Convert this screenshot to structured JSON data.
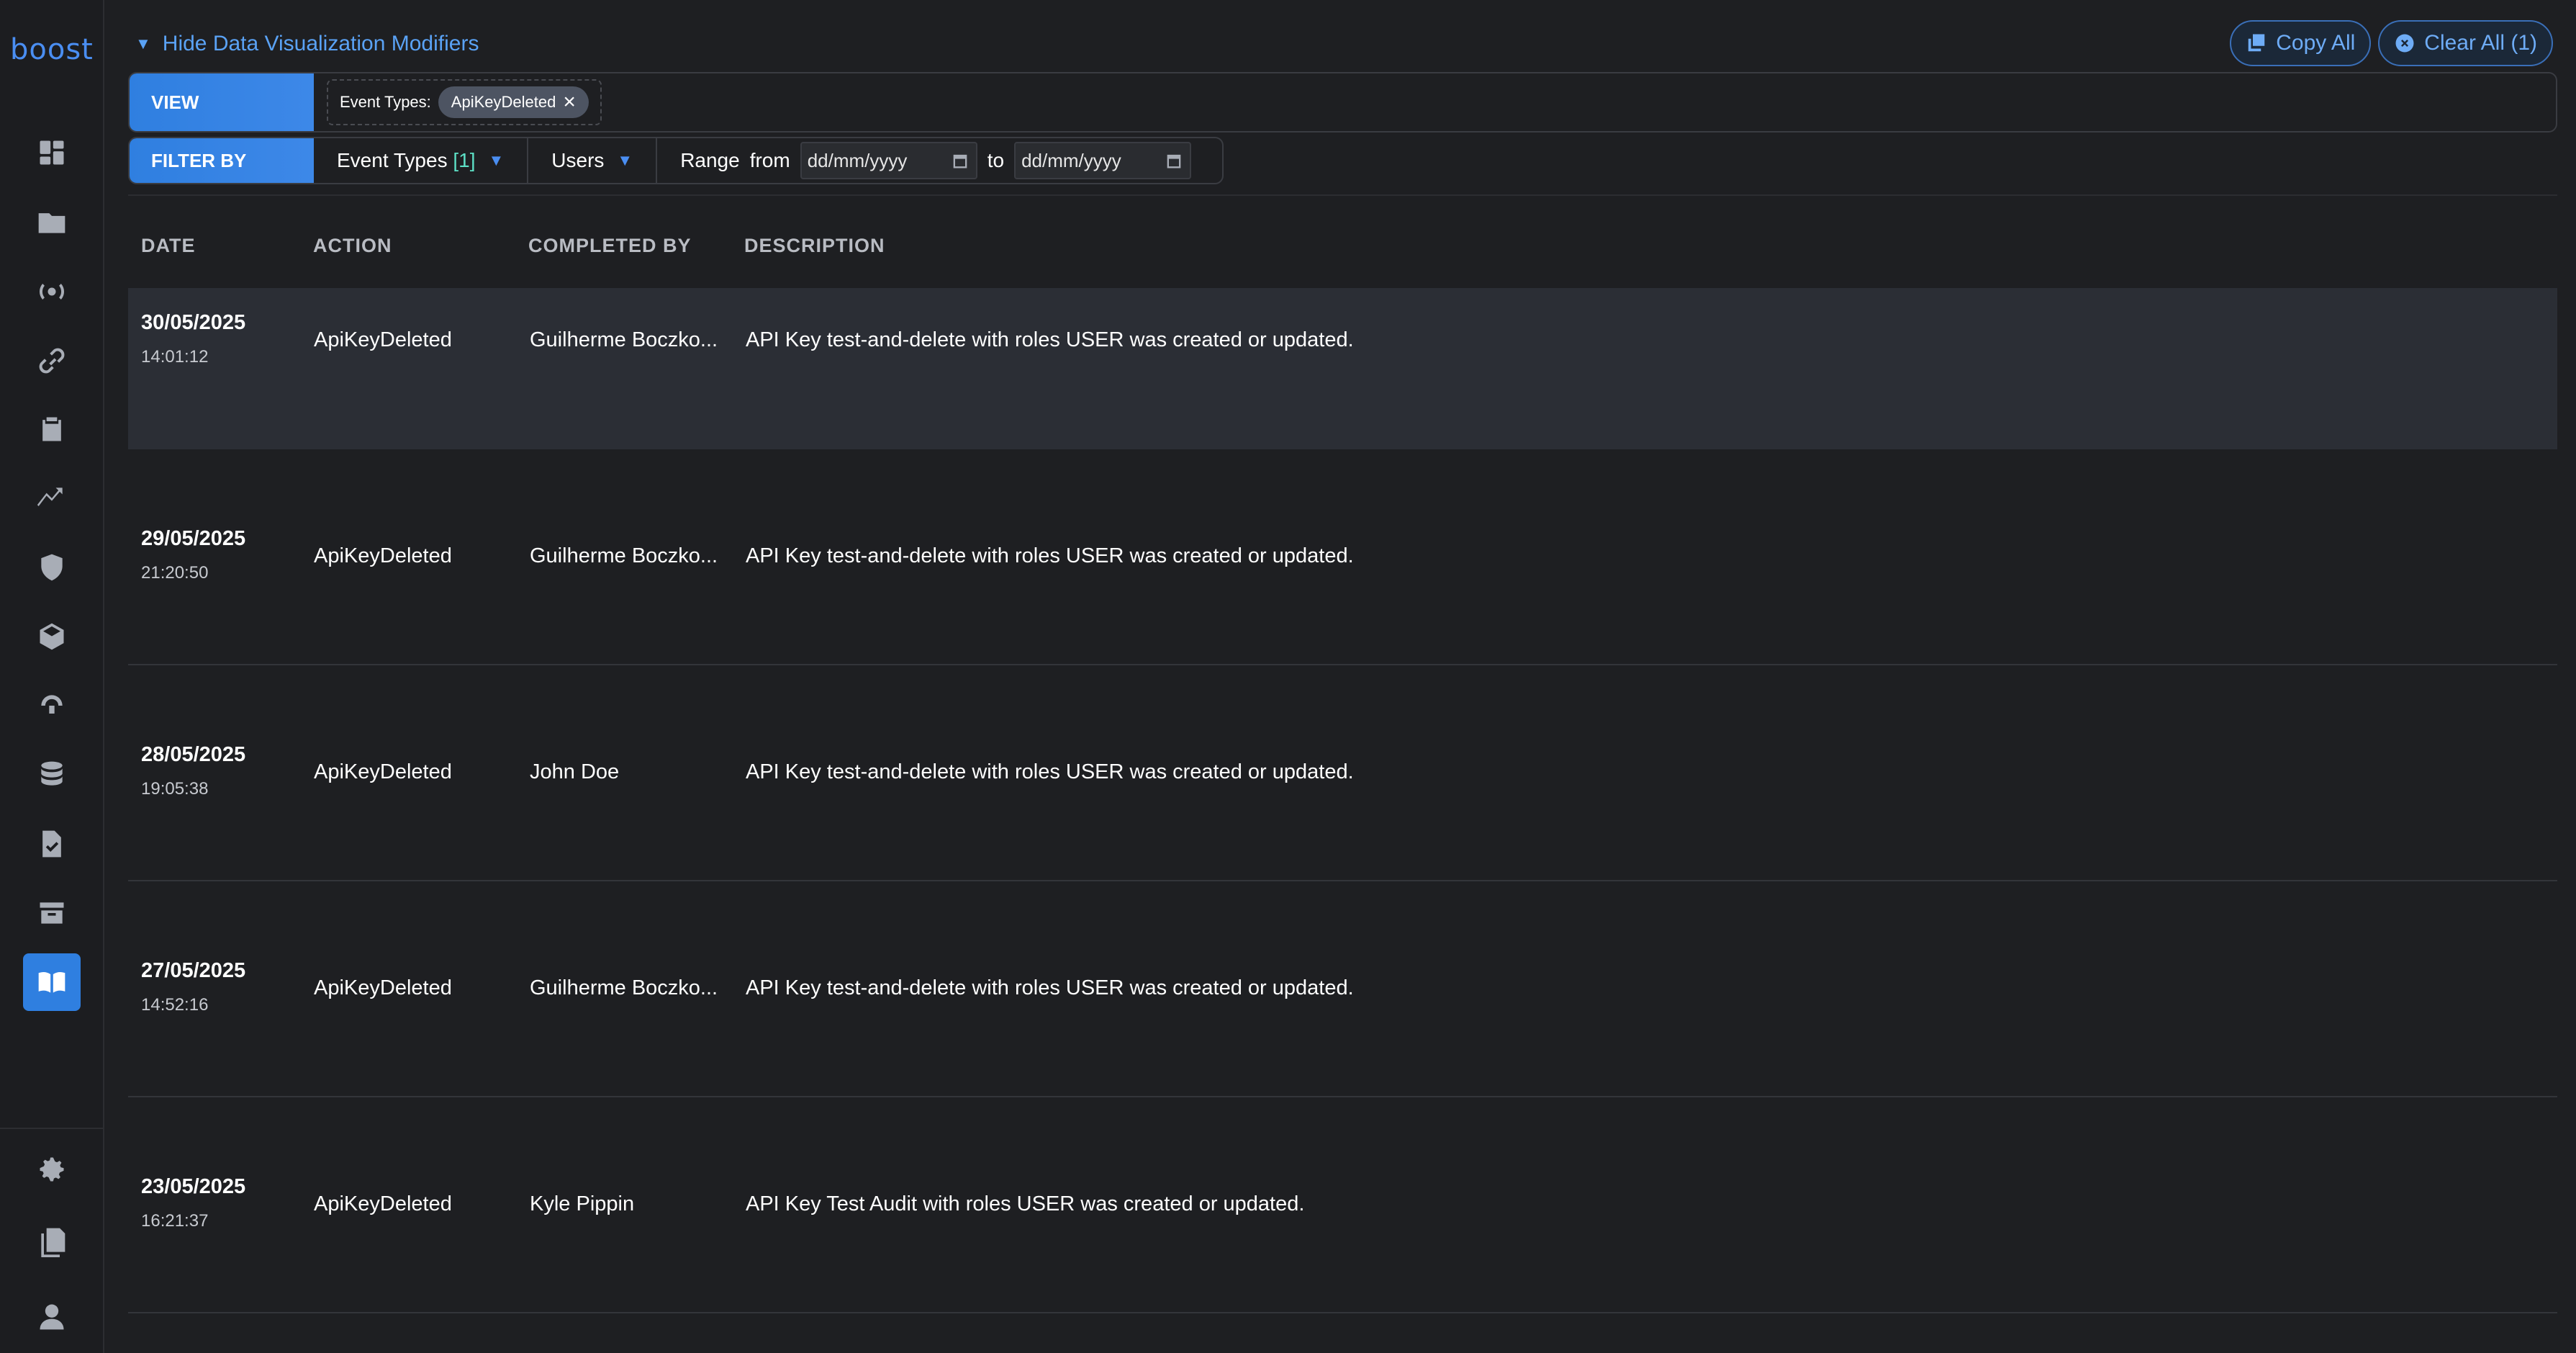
{
  "app": {
    "logo": "boost"
  },
  "sidebar": {
    "items": [
      {
        "icon": "dashboard-icon"
      },
      {
        "icon": "folder-icon"
      },
      {
        "icon": "broadcast-icon"
      },
      {
        "icon": "link-icon"
      },
      {
        "icon": "clipboard-icon"
      },
      {
        "icon": "trend-icon"
      },
      {
        "icon": "shield-icon"
      },
      {
        "icon": "cube-icon"
      },
      {
        "icon": "brain-icon"
      },
      {
        "icon": "database-icon"
      },
      {
        "icon": "file-check-icon"
      },
      {
        "icon": "archive-icon"
      },
      {
        "icon": "book-icon",
        "active": true
      }
    ],
    "bottom": [
      {
        "icon": "gear-icon"
      },
      {
        "icon": "documents-icon"
      },
      {
        "icon": "user-icon"
      }
    ]
  },
  "header": {
    "toggle_label": "Hide Data Visualization Modifiers",
    "copy_all": "Copy All",
    "clear_all": "Clear All (1)"
  },
  "view": {
    "label": "VIEW",
    "chip_label": "Event Types:",
    "chip_value": "ApiKeyDeleted"
  },
  "filter": {
    "label": "FILTER BY",
    "event_types": "Event Types",
    "event_types_count": "[1]",
    "users": "Users",
    "range": "Range",
    "from": "from",
    "to": "to",
    "from_placeholder": "dd/mm/yyyy",
    "to_placeholder": "dd/mm/yyyy"
  },
  "table": {
    "columns": [
      "DATE",
      "ACTION",
      "COMPLETED BY",
      "DESCRIPTION"
    ],
    "rows": [
      {
        "date": "30/05/2025",
        "time": "14:01:12",
        "action": "ApiKeyDeleted",
        "by": "Guilherme Boczko...",
        "description": "API Key test-and-delete with roles USER was created or updated."
      },
      {
        "date": "29/05/2025",
        "time": "21:20:50",
        "action": "ApiKeyDeleted",
        "by": "Guilherme Boczko...",
        "description": "API Key test-and-delete with roles USER was created or updated."
      },
      {
        "date": "28/05/2025",
        "time": "19:05:38",
        "action": "ApiKeyDeleted",
        "by": "John Doe",
        "description": "API Key test-and-delete with roles USER was created or updated."
      },
      {
        "date": "27/05/2025",
        "time": "14:52:16",
        "action": "ApiKeyDeleted",
        "by": "Guilherme Boczko...",
        "description": "API Key test-and-delete with roles USER was created or updated."
      },
      {
        "date": "23/05/2025",
        "time": "16:21:37",
        "action": "ApiKeyDeleted",
        "by": "Kyle Pippin",
        "description": "API Key Test Audit with roles USER was created or updated."
      }
    ]
  }
}
